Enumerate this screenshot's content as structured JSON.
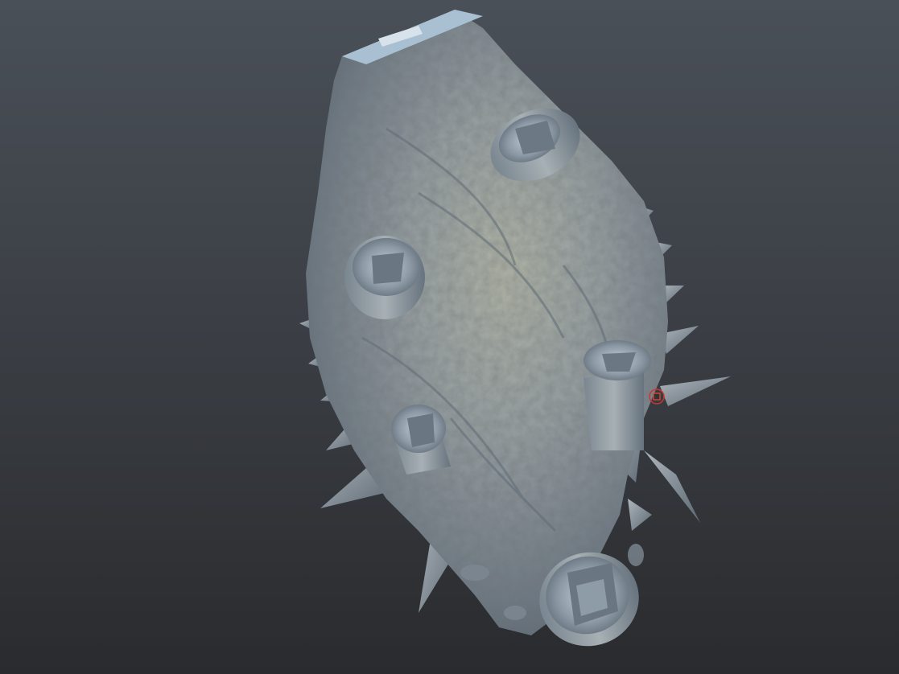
{
  "viewport": {
    "background_top": "#4a5058",
    "background_bottom": "#2a2b2e",
    "mesh_color": "#8e9aa4",
    "mesh_highlight": "#b9bca8",
    "mesh_shadow": "#4f5962",
    "cursor_color": "#d0342c"
  },
  "model": {
    "icon": "sculpted-creature-mesh",
    "openings": 6,
    "spikes": 14
  },
  "brush_cursor": {
    "icon": "brush-cursor-icon"
  }
}
